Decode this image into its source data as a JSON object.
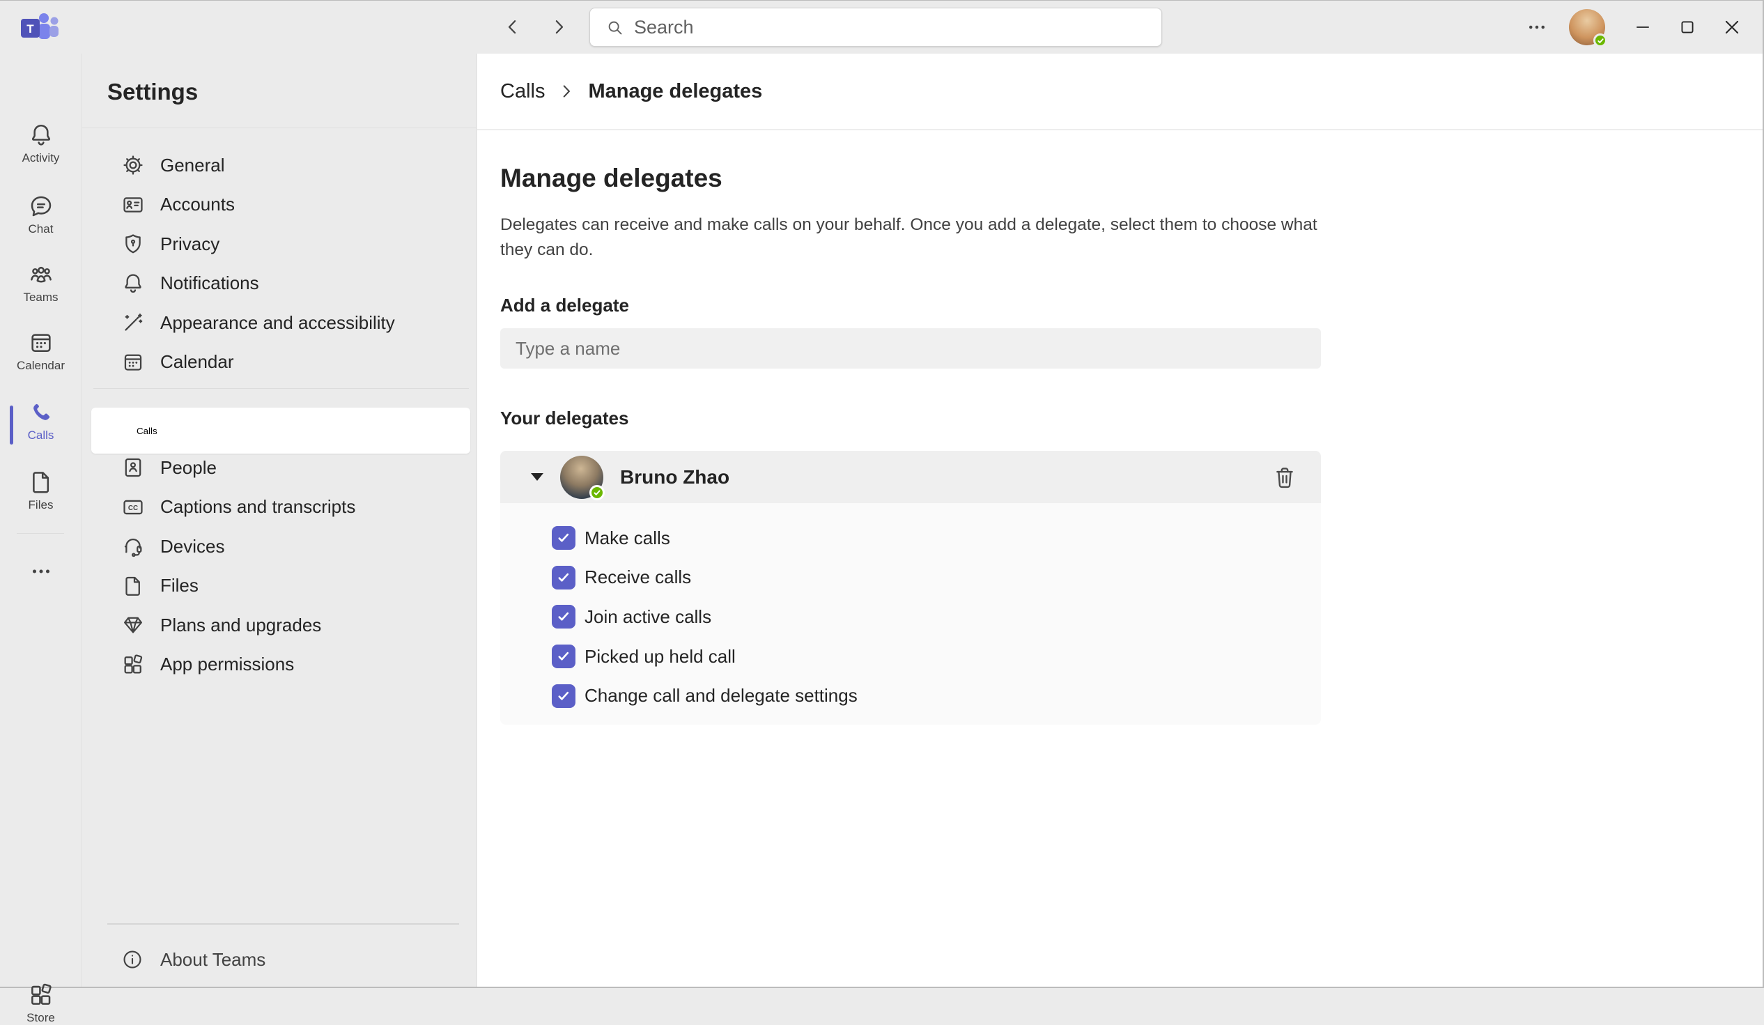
{
  "colors": {
    "accent": "#5b5fc7",
    "presence_green": "#6bb700",
    "surface": "#ebebeb"
  },
  "titlebar": {
    "search_placeholder": "Search"
  },
  "rail": {
    "items": [
      {
        "label": "Activity"
      },
      {
        "label": "Chat"
      },
      {
        "label": "Teams"
      },
      {
        "label": "Calendar"
      },
      {
        "label": "Calls",
        "active": true
      },
      {
        "label": "Files"
      }
    ],
    "store_label": "Store"
  },
  "sidebar": {
    "title": "Settings",
    "group1": [
      {
        "label": "General",
        "icon": "gear-icon"
      },
      {
        "label": "Accounts",
        "icon": "id-card-icon"
      },
      {
        "label": "Privacy",
        "icon": "shield-icon"
      },
      {
        "label": "Notifications",
        "icon": "bell-icon"
      },
      {
        "label": "Appearance and accessibility",
        "icon": "wand-icon"
      },
      {
        "label": "Calendar",
        "icon": "calendar-icon"
      }
    ],
    "group2": [
      {
        "label": "Calls",
        "icon": "phone-icon",
        "selected": true
      },
      {
        "label": "People",
        "icon": "people-book-icon"
      },
      {
        "label": "Captions and transcripts",
        "icon": "cc-icon"
      },
      {
        "label": "Devices",
        "icon": "headset-icon"
      },
      {
        "label": "Files",
        "icon": "file-icon"
      },
      {
        "label": "Plans and upgrades",
        "icon": "diamond-icon"
      },
      {
        "label": "App permissions",
        "icon": "app-grid-icon"
      }
    ],
    "about_label": "About Teams"
  },
  "breadcrumb": {
    "parent": "Calls",
    "current": "Manage delegates"
  },
  "main": {
    "title": "Manage delegates",
    "description": "Delegates can receive and make calls on your behalf. Once you add a delegate, select them to choose what they can do.",
    "add_delegate_label": "Add a delegate",
    "input_placeholder": "Type a name",
    "your_delegates_label": "Your delegates",
    "delegate": {
      "name": "Bruno Zhao",
      "status": "available",
      "expanded": true,
      "permissions": [
        "Make calls",
        "Receive calls",
        "Join active calls",
        "Picked up held call",
        "Change call and delegate settings"
      ],
      "permissions_checked": [
        true,
        true,
        true,
        true,
        true
      ]
    }
  }
}
